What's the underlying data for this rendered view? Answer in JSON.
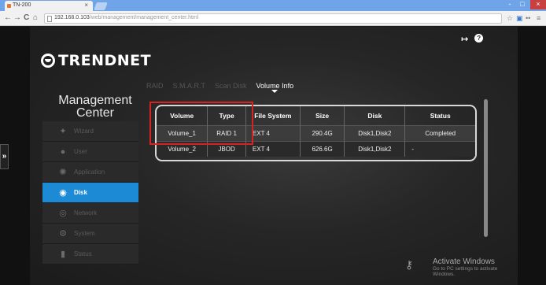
{
  "browser": {
    "tab_title": "TN-200",
    "tab_close": "×",
    "url_host": "192.168.0.103",
    "url_path": "/web/management/management_center.html",
    "window_controls": [
      "-",
      "□",
      "×"
    ],
    "nav": {
      "back": "←",
      "forward": "→",
      "reload": "C",
      "home": "⌂"
    },
    "toolbar_icons": [
      "☆",
      "▣",
      "••",
      "≡"
    ]
  },
  "app": {
    "logo_text": "TRENDNET",
    "top_icons": {
      "logout": "↦",
      "help": "?"
    },
    "title": "Management Center",
    "collapse_label": "»",
    "sidebar": [
      {
        "label": "Wizard",
        "icon": "wand-icon",
        "glyph": "✦",
        "active": false
      },
      {
        "label": "User",
        "icon": "user-icon",
        "glyph": "●",
        "active": false
      },
      {
        "label": "Application",
        "icon": "gear-icon",
        "glyph": "✺",
        "active": false
      },
      {
        "label": "Disk",
        "icon": "disk-icon",
        "glyph": "◉",
        "active": true
      },
      {
        "label": "Network",
        "icon": "network-icon",
        "glyph": "◎",
        "active": false
      },
      {
        "label": "System",
        "icon": "system-icon",
        "glyph": "⚙",
        "active": false
      },
      {
        "label": "Status",
        "icon": "status-icon",
        "glyph": "▮",
        "active": false
      }
    ],
    "subtabs": [
      {
        "label": "RAID",
        "active": false
      },
      {
        "label": "S.M.A.R.T",
        "active": false
      },
      {
        "label": "Scan Disk",
        "active": false
      },
      {
        "label": "Volume Info",
        "active": true
      }
    ],
    "table": {
      "columns": [
        "Volume",
        "Type",
        "File System",
        "Size",
        "Disk",
        "Status"
      ],
      "rows": [
        [
          "Volume_1",
          "RAID 1",
          "EXT 4",
          "290.4G",
          "Disk1,Disk2",
          "Completed"
        ],
        [
          "Volume_2",
          "JBOD",
          "EXT 4",
          "626.6G",
          "Disk1,Disk2",
          "-"
        ]
      ]
    },
    "highlight_color": "#d62222",
    "accent_color": "#1d8ad6"
  },
  "watermark": {
    "line1": "Activate Windows",
    "line2": "Go to PC settings to activate Windows."
  }
}
